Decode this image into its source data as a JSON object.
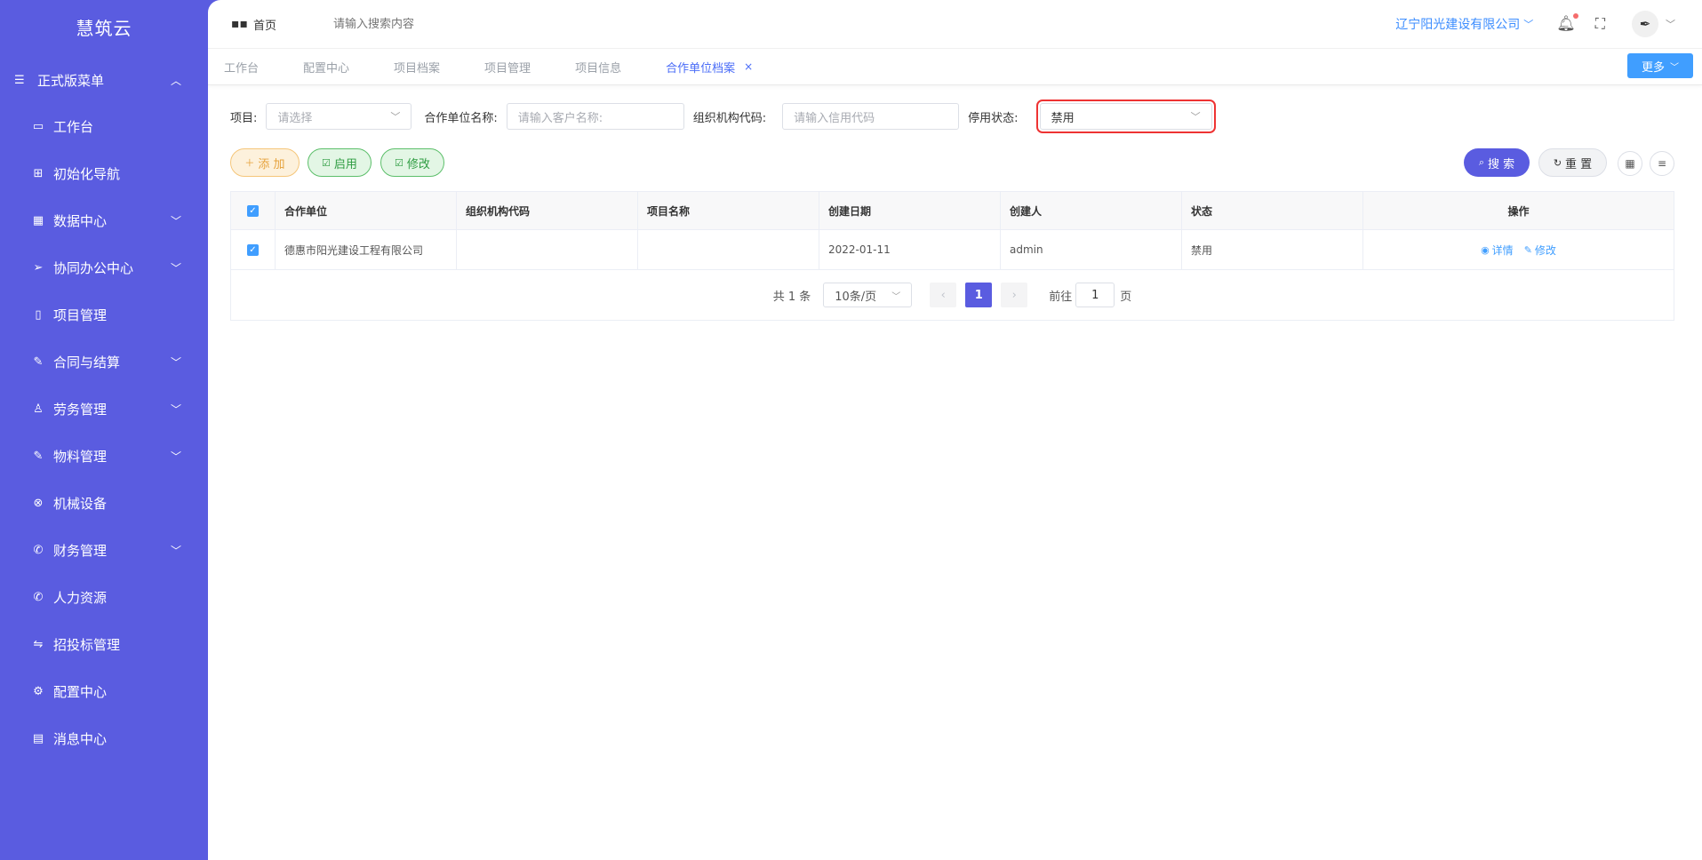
{
  "app": {
    "brand": "慧筑云"
  },
  "sidebar": {
    "root": {
      "label": "正式版菜单",
      "icon": "menu-doc-icon"
    },
    "items": [
      {
        "label": "工作台",
        "icon": "monitor-icon",
        "arrow": false
      },
      {
        "label": "初始化导航",
        "icon": "sitemap-icon",
        "arrow": false
      },
      {
        "label": "数据中心",
        "icon": "grid-icon",
        "arrow": true
      },
      {
        "label": "协同办公中心",
        "icon": "send-icon",
        "arrow": true
      },
      {
        "label": "项目管理",
        "icon": "book-icon",
        "arrow": false
      },
      {
        "label": "合同与结算",
        "icon": "contract-icon",
        "arrow": true
      },
      {
        "label": "劳务管理",
        "icon": "worker-icon",
        "arrow": true
      },
      {
        "label": "物料管理",
        "icon": "material-icon",
        "arrow": true
      },
      {
        "label": "机械设备",
        "icon": "machine-icon",
        "arrow": false
      },
      {
        "label": "财务管理",
        "icon": "finance-icon",
        "arrow": true
      },
      {
        "label": "人力资源",
        "icon": "phone-icon",
        "arrow": false
      },
      {
        "label": "招投标管理",
        "icon": "bid-icon",
        "arrow": false
      },
      {
        "label": "配置中心",
        "icon": "gear-icon",
        "arrow": false
      },
      {
        "label": "消息中心",
        "icon": "message-icon",
        "arrow": false
      }
    ]
  },
  "topbar": {
    "home_label": "首页",
    "search_placeholder": "请输入搜索内容",
    "company": "辽宁阳光建设有限公司"
  },
  "tabs": [
    {
      "label": "工作台",
      "active": false
    },
    {
      "label": "配置中心",
      "active": false
    },
    {
      "label": "项目档案",
      "active": false
    },
    {
      "label": "项目管理",
      "active": false
    },
    {
      "label": "项目信息",
      "active": false
    },
    {
      "label": "合作单位档案",
      "active": true
    }
  ],
  "more_label": "更多",
  "filters": {
    "project_label": "项目:",
    "project_placeholder": "请选择",
    "partner_label": "合作单位名称:",
    "partner_placeholder": "请输入客户名称:",
    "org_label": "组织机构代码:",
    "org_placeholder": "请输入信用代码",
    "status_label": "停用状态:",
    "status_value": "禁用"
  },
  "actions": {
    "add": "添 加",
    "enable": "启用",
    "edit": "修改",
    "search": "搜 索",
    "reset": "重 置"
  },
  "table": {
    "headers": [
      "合作单位",
      "组织机构代码",
      "项目名称",
      "创建日期",
      "创建人",
      "状态",
      "操作"
    ],
    "rows": [
      {
        "partner": "德惠市阳光建设工程有限公司",
        "org_code": "",
        "project": "",
        "date": "2022-01-11",
        "creator": "admin",
        "status": "禁用",
        "op_detail": "详情",
        "op_edit": "修改"
      }
    ]
  },
  "pager": {
    "total": "共 1 条",
    "page_size": "10条/页",
    "current": "1",
    "goto_label": "前往",
    "goto_value": "1",
    "page_suffix": "页"
  }
}
